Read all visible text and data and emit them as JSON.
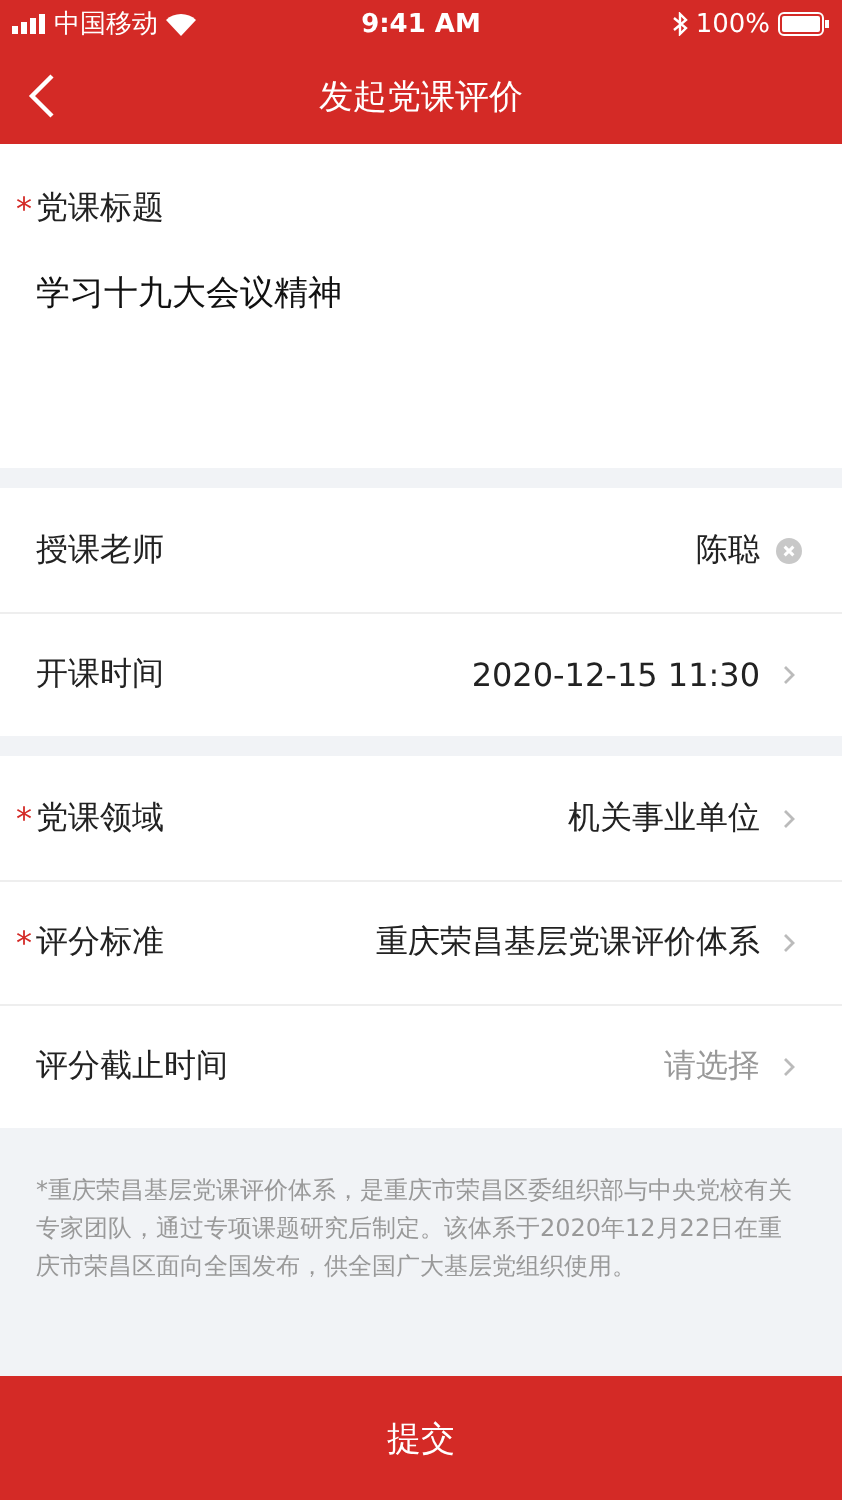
{
  "status_bar": {
    "carrier": "中国移动",
    "time": "9:41 AM",
    "battery": "100%"
  },
  "nav": {
    "title": "发起党课评价"
  },
  "title_field": {
    "label": "党课标题",
    "required_mark": "*",
    "value": "学习十九大会议精神"
  },
  "groups": [
    {
      "rows": [
        {
          "label": "授课老师",
          "value": "陈聪",
          "kind": "clear"
        },
        {
          "label": "开课时间",
          "value": "2020-12-15 11:30",
          "kind": "chevron"
        }
      ]
    },
    {
      "rows": [
        {
          "label": "党课领域",
          "required_mark": "*",
          "value": "机关事业单位",
          "kind": "chevron"
        },
        {
          "label": "评分标准",
          "required_mark": "*",
          "value": "重庆荣昌基层党课评价体系",
          "kind": "chevron"
        },
        {
          "label": "评分截止时间",
          "placeholder": "请选择",
          "kind": "chevron"
        }
      ]
    }
  ],
  "note": "*重庆荣昌基层党课评价体系，是重庆市荣昌区委组织部与中央党校有关专家团队，通过专项课题研究后制定。该体系于2020年12月22日在重庆市荣昌区面向全国发布，供全国广大基层党组织使用。",
  "submit": {
    "label": "提交"
  }
}
